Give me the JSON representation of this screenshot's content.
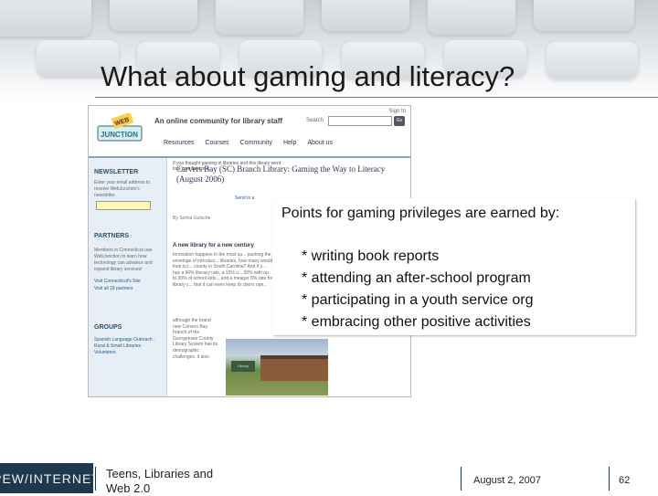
{
  "slide": {
    "title": "What about gaming and literacy?"
  },
  "screenshot": {
    "logo_top": "WEB",
    "logo_bottom": "JUNCTION",
    "tagline": "An online community for library staff",
    "sign_in": "Sign In",
    "search_label": "Search",
    "go_label": "Go",
    "nav_items": [
      "Resources",
      "Courses",
      "Community",
      "Help",
      "About us"
    ],
    "sidebar": {
      "newsletter_heading": "NEWSLETTER",
      "newsletter_text": "Enter your email address to receive WebJunction's newsletter.",
      "partners_heading": "PARTNERS",
      "partners_text": "Members in Connecticut use WebJunction to learn how technology can advance and expand library services!",
      "partners_link": "Visit Connecticut's Site",
      "partners_link2": "Visit all 18 partners",
      "groups_heading": "GROUPS",
      "groups_items": "Spanish Language Outreach · Rural & Small Libraries · Volunteers"
    },
    "article_intro": "If you thought gaming in libraries and this library went to a corn field in e...",
    "article_title": "Carvers Bay (SC) Branch Library: Gaming the Way to Literacy (August 2006)",
    "send_to": "Send to a",
    "byline": "By Selma Gutsche",
    "subhead": "A new library for a new century",
    "article_body": "Innovation happens in the most su... pushing the envelope of introduci... libraries, how many would look to t... county in South Carolina? And if y... has a 96% literacy rate, a 15% u... 30% with up to 30% of school kids... and a meager 8% rate for library c... that it can even keep its doors ope...",
    "article_body2": "although the brand new Carvers Bay branch of the Georgetown County Library System has its demographic challenges, it also",
    "photo_sign": "Library"
  },
  "callout": {
    "heading": "Points for gaming privileges are earned by:",
    "items": [
      "* writing book reports",
      "* attending an after-school program",
      "* participating in a youth service org",
      "* embracing other positive activities"
    ]
  },
  "footer": {
    "logo": "PEW/INTERNET",
    "text_line1": "Teens, Libraries and",
    "text_line2": "Web 2.0",
    "date": "August 2, 2007",
    "page": "62"
  }
}
